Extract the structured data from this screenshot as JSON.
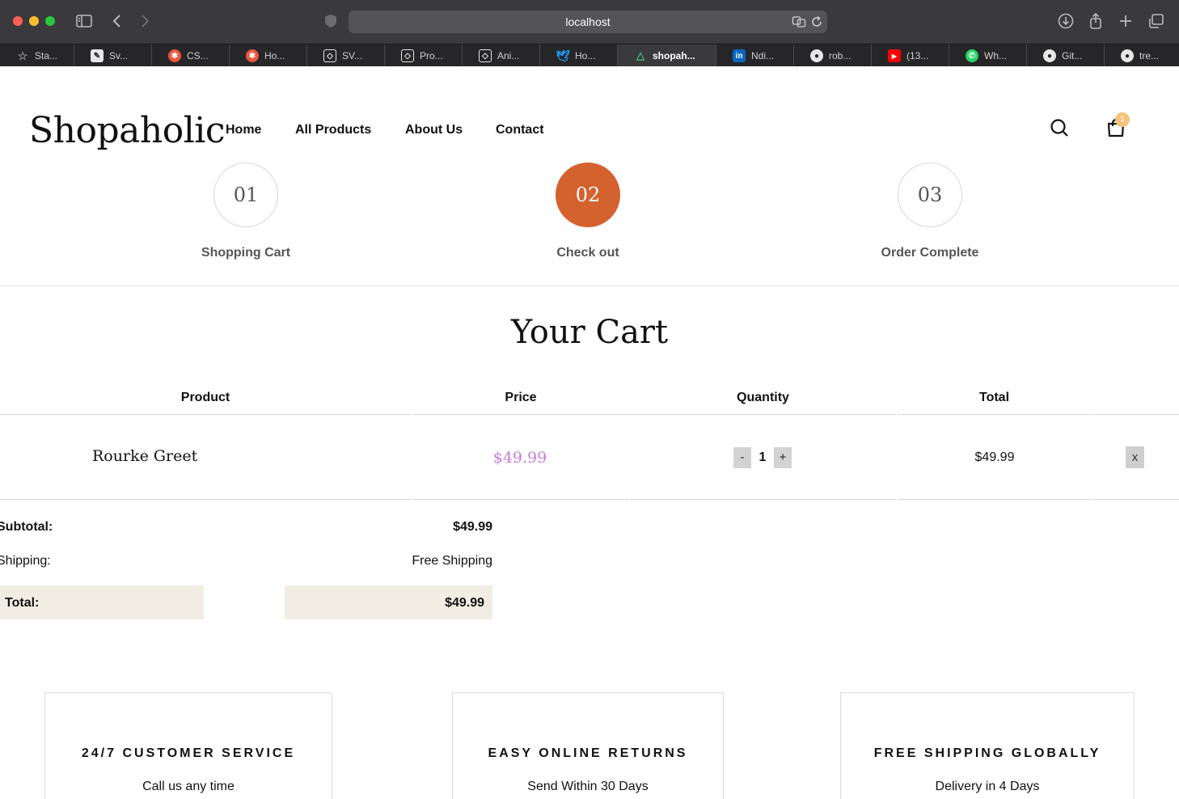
{
  "browser": {
    "url": "localhost",
    "tabs": [
      {
        "label": "Sta...",
        "icon": "star-icon",
        "color": "#8e8e93"
      },
      {
        "label": "Sv...",
        "icon": "pen-icon",
        "color": "#e6e6e6"
      },
      {
        "label": "CS...",
        "icon": "flower-icon",
        "color": "#e9573f"
      },
      {
        "label": "Ho...",
        "icon": "flower-icon",
        "color": "#e9573f"
      },
      {
        "label": "SV...",
        "icon": "codepen-icon",
        "color": "#e6e6e6"
      },
      {
        "label": "Pro...",
        "icon": "codepen-icon",
        "color": "#e6e6e6"
      },
      {
        "label": "Ani...",
        "icon": "codepen-icon",
        "color": "#e6e6e6"
      },
      {
        "label": "Ho...",
        "icon": "twitter-icon",
        "color": "#1d9bf0"
      },
      {
        "label": "shopah...",
        "icon": "vue-icon",
        "color": "#41b883"
      },
      {
        "label": "Ndi...",
        "icon": "linkedin-icon",
        "color": "#0a66c2"
      },
      {
        "label": "rob...",
        "icon": "github-icon",
        "color": "#e6e6e6"
      },
      {
        "label": "(13...",
        "icon": "youtube-icon",
        "color": "#ff0000"
      },
      {
        "label": "Wh...",
        "icon": "whatsapp-icon",
        "color": "#25d366"
      },
      {
        "label": "Git...",
        "icon": "github-icon",
        "color": "#e6e6e6"
      },
      {
        "label": "tre...",
        "icon": "github-icon",
        "color": "#e6e6e6"
      }
    ]
  },
  "header": {
    "logo": "Shopaholic",
    "nav": [
      "Home",
      "All Products",
      "About Us",
      "Contact"
    ],
    "cart_count": "1"
  },
  "steps": [
    {
      "number": "01",
      "label": "Shopping Cart",
      "active": false
    },
    {
      "number": "02",
      "label": "Check out",
      "active": true
    },
    {
      "number": "03",
      "label": "Order Complete",
      "active": false
    }
  ],
  "cart": {
    "title": "Your Cart",
    "columns": [
      "Product",
      "Price",
      "Quantity",
      "Total"
    ],
    "items": [
      {
        "product": "Rourke Greet",
        "price": "$49.99",
        "quantity": "1",
        "total": "$49.99",
        "decrement": "-",
        "increment": "+",
        "remove": "x"
      }
    ],
    "summary": {
      "subtotal_label": "Subtotal:",
      "subtotal_value": "$49.99",
      "shipping_label": "Shipping:",
      "shipping_value": "Free Shipping",
      "total_label": "Total:",
      "total_value": "$49.99"
    }
  },
  "features": [
    {
      "title": "24/7 CUSTOMER SERVICE",
      "subtitle": "Call us any time"
    },
    {
      "title": "EASY ONLINE RETURNS",
      "subtitle": "Send Within 30 Days"
    },
    {
      "title": "FREE SHIPPING GLOBALLY",
      "subtitle": "Delivery in 4 Days"
    }
  ],
  "colors": {
    "accent": "#d4622f",
    "price": "#c77dd9",
    "total_bg": "#f2ede3",
    "badge": "#f4c27a"
  }
}
